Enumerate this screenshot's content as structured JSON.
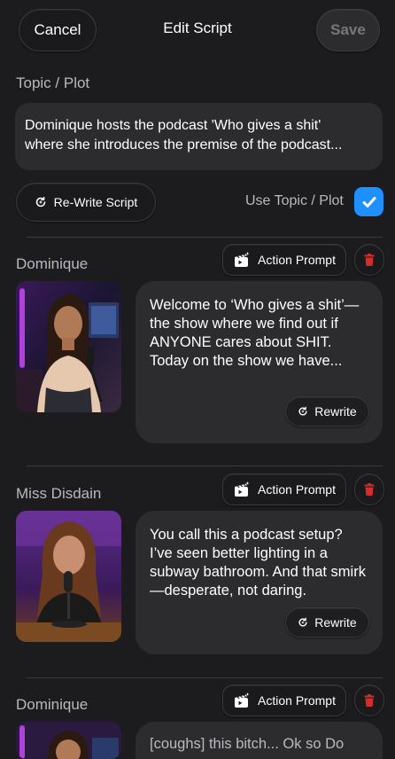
{
  "header": {
    "cancel_label": "Cancel",
    "title": "Edit Script",
    "save_label": "Save"
  },
  "topic": {
    "label": "Topic / Plot",
    "line1": "Dominique hosts the podcast 'Who gives a shit'",
    "line2": "where she introduces the premise of the podcast..."
  },
  "rewrite_script_label": "Re-Write Script",
  "use_topic_label": "Use Topic / Plot",
  "use_topic_checked": true,
  "action_prompt_label": "Action Prompt",
  "rewrite_label": "Rewrite",
  "colors": {
    "accent": "#1e90ff",
    "delete": "#d42b2b",
    "background": "#1c1c1e",
    "surface": "#2c2c2e"
  },
  "lines": [
    {
      "speaker": "Dominique",
      "text": "Welcome to ‘Who gives a shit’—the show where we find out if ANYONE cares about SHIT. Today on the show we have..."
    },
    {
      "speaker": "Miss Disdain",
      "text": "You call this a podcast setup? I’ve seen better lighting in a subway bathroom. And that smirk—desperate, not daring."
    },
    {
      "speaker": "Dominique",
      "text": "[coughs] this bitch... Ok so Do"
    }
  ]
}
